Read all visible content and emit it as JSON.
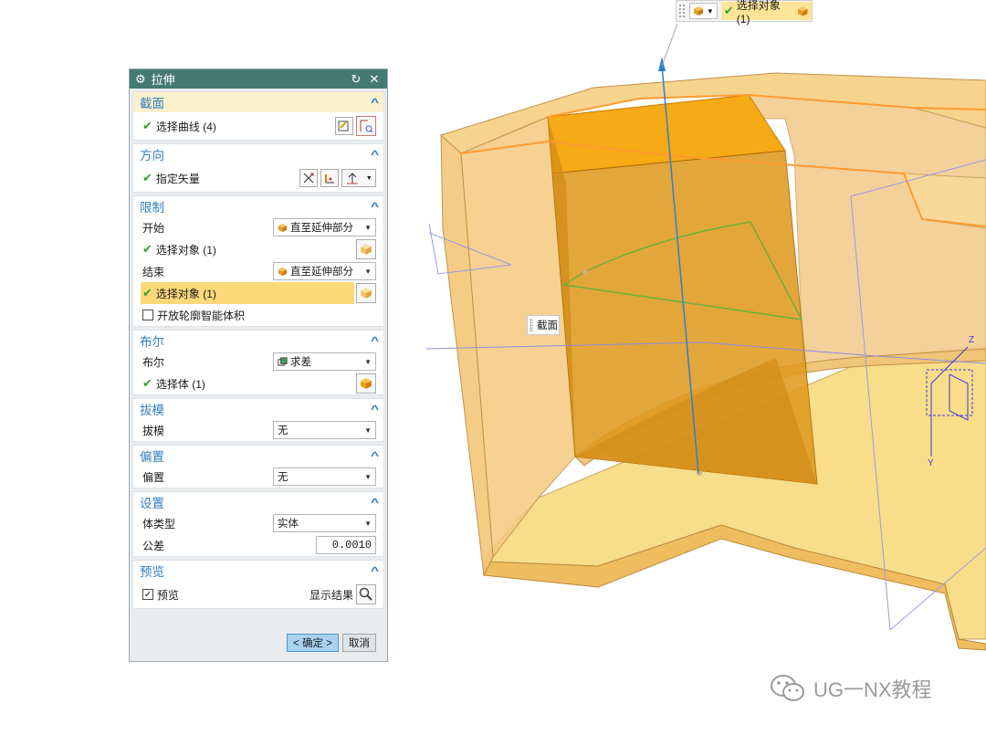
{
  "selection_toolbar": {
    "status_text": "选择对象 (1)"
  },
  "dialog": {
    "title": "拉伸",
    "section": {
      "title": "截面",
      "select_curve": "选择曲线 (4)"
    },
    "direction": {
      "title": "方向",
      "specify_vector": "指定矢量"
    },
    "limits": {
      "title": "限制",
      "start_label": "开始",
      "start_value": "直至延伸部分",
      "start_select": "选择对象 (1)",
      "end_label": "结束",
      "end_value": "直至延伸部分",
      "end_select": "选择对象 (1)",
      "open_profile": "开放轮廓智能体积"
    },
    "boolean": {
      "title": "布尔",
      "label": "布尔",
      "value": "求差",
      "select_body": "选择体 (1)"
    },
    "draft": {
      "title": "拔模",
      "label": "拔模",
      "value": "无"
    },
    "offset": {
      "title": "偏置",
      "label": "偏置",
      "value": "无"
    },
    "settings": {
      "title": "设置",
      "body_type_label": "体类型",
      "body_type_value": "实体",
      "tolerance_label": "公差",
      "tolerance_value": "0.0010"
    },
    "preview": {
      "title": "预览",
      "checkbox_label": "预览",
      "show_result": "显示结果"
    },
    "ok_label": "< 确定 >",
    "cancel_label": "取消"
  },
  "viewport": {
    "section_label": "截面",
    "axis_z": "Z",
    "axis_y": "Y"
  },
  "watermark": "UG一NX教程",
  "colors": {
    "title_bar": "#457a73",
    "section_header": "#2f7ec0",
    "highlight": "#fcd878",
    "model_face": "#f1cf7b",
    "extrude_body": "#e29a1c"
  }
}
